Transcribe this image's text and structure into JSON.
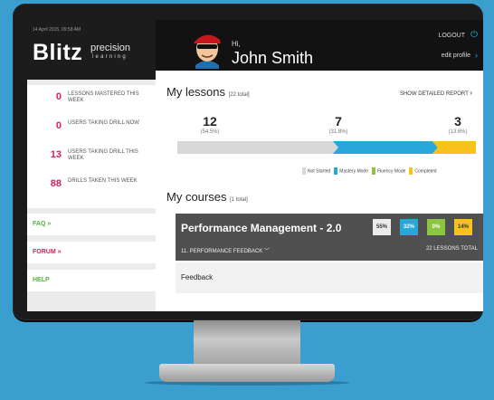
{
  "sidebar": {
    "date": "14 April 2015, 09:58 AM",
    "brand_main": "Blitz",
    "brand_precision": "precision",
    "brand_learning": "learning",
    "stats": [
      {
        "value": "0",
        "label": "LESSONS MASTERED THIS WEEK"
      },
      {
        "value": "0",
        "label": "USERS TAKING DRILL NOW"
      },
      {
        "value": "13",
        "label": "USERS TAKING DRILL THIS WEEK"
      },
      {
        "value": "88",
        "label": "DRILLS TAKEN THIS WEEK"
      }
    ],
    "nav": [
      {
        "label": "FAQ »"
      },
      {
        "label": "FORUM »"
      },
      {
        "label": "HELP"
      }
    ]
  },
  "header": {
    "greeting": "Hi,",
    "user_name": "John Smith",
    "logout_label": "LOGOUT",
    "edit_profile_label": "edit profile"
  },
  "lessons": {
    "title": "My lessons",
    "total": "[22 total]",
    "report_label": "SHOW DETAILED REPORT",
    "stats": [
      {
        "value": "12",
        "percent": "(54.5%)"
      },
      {
        "value": "7",
        "percent": "(31.8%)"
      },
      {
        "value": "3",
        "percent": "(13.6%)"
      }
    ],
    "progress": {
      "not_started": 0.5,
      "mastery": 0.32,
      "fluency": 0.0,
      "completed": 0.14
    },
    "legend": [
      {
        "label": "Not Started",
        "color": "#d8d8d8"
      },
      {
        "label": "Mastery Mode",
        "color": "#27a8d8"
      },
      {
        "label": "Fluency Mode",
        "color": "#8cc63e"
      },
      {
        "label": "Completed",
        "color": "#f7c21b"
      }
    ]
  },
  "courses": {
    "title": "My courses",
    "total": "[1 total]",
    "course": {
      "name": "Performance Management - 2.0",
      "section": "11. PERFORMANCE FEEDBACK",
      "lessons_total": "22 LESSONS TOTAL",
      "badges": [
        {
          "value": "55%",
          "color": "#ececec",
          "text_color": "#333"
        },
        {
          "value": "32%",
          "color": "#27a8d8",
          "text_color": "#fff"
        },
        {
          "value": "0%",
          "color": "#8cc63e",
          "text_color": "#fff"
        },
        {
          "value": "14%",
          "color": "#f7c21b",
          "text_color": "#333"
        }
      ]
    },
    "item": "Feedback"
  }
}
